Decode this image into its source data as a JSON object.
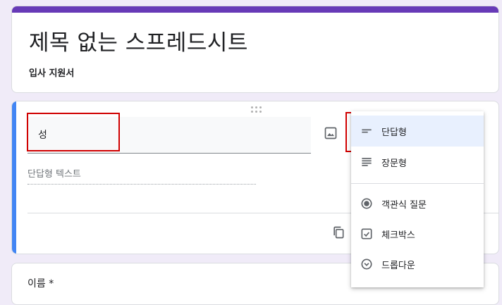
{
  "form": {
    "title": "제목 없는 스프레드시트",
    "description": "입사 지원서"
  },
  "question": {
    "title_value": "성",
    "answer_hint": "단답형 텍스트"
  },
  "next_question": {
    "peek_text": "이름 *"
  },
  "type_menu": {
    "items": [
      {
        "label": "단답형",
        "icon": "short-answer-icon",
        "selected": true
      },
      {
        "label": "장문형",
        "icon": "paragraph-icon",
        "selected": false
      },
      {
        "label": "객관식 질문",
        "icon": "radio-icon",
        "selected": false
      },
      {
        "label": "체크박스",
        "icon": "checkbox-icon",
        "selected": false
      },
      {
        "label": "드롭다운",
        "icon": "dropdown-icon",
        "selected": false
      }
    ]
  },
  "colors": {
    "theme": "#673ab7",
    "active_question": "#4285f4",
    "annotation": "#d00000",
    "menu_selected": "#e8f0fe"
  }
}
